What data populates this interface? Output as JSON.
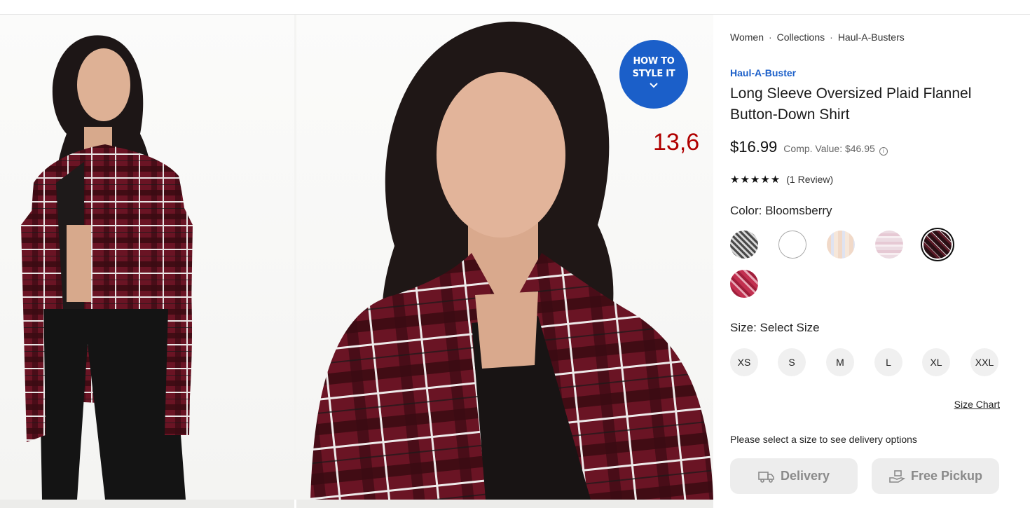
{
  "gallery": {
    "style_badge": {
      "line1": "HOW TO",
      "line2": "STYLE IT"
    },
    "counter": "13,6"
  },
  "product": {
    "breadcrumbs": [
      "Women",
      "Collections",
      "Haul-A-Busters"
    ],
    "brand": "Haul-A-Buster",
    "title": "Long Sleeve Oversized Plaid Flannel Button-Down Shirt",
    "price": "$16.99",
    "comp_value": "Comp. Value: $46.95",
    "rating": {
      "stars": 5,
      "stars_text": "★★★★★",
      "reviews": "(1 Review)"
    },
    "color": {
      "label": "Color:",
      "selected": "Bloomsberry"
    },
    "swatch_colors": [
      "#6b6b6b",
      "#ffffff",
      "#e9d2c3",
      "#ead6de",
      "#2a0f14",
      "#c23050"
    ],
    "size": {
      "label": "Size:",
      "selected": "Select Size",
      "options": [
        "XS",
        "S",
        "M",
        "L",
        "XL",
        "XXL"
      ]
    },
    "size_chart": "Size Chart",
    "delivery_note": "Please select a size to see delivery options",
    "fulfillment": {
      "delivery": "Delivery",
      "pickup": "Free Pickup"
    }
  },
  "colors": {
    "accent_blue": "#1b5fc9",
    "counter_red": "#b00000",
    "shirt": "#6a1424"
  }
}
